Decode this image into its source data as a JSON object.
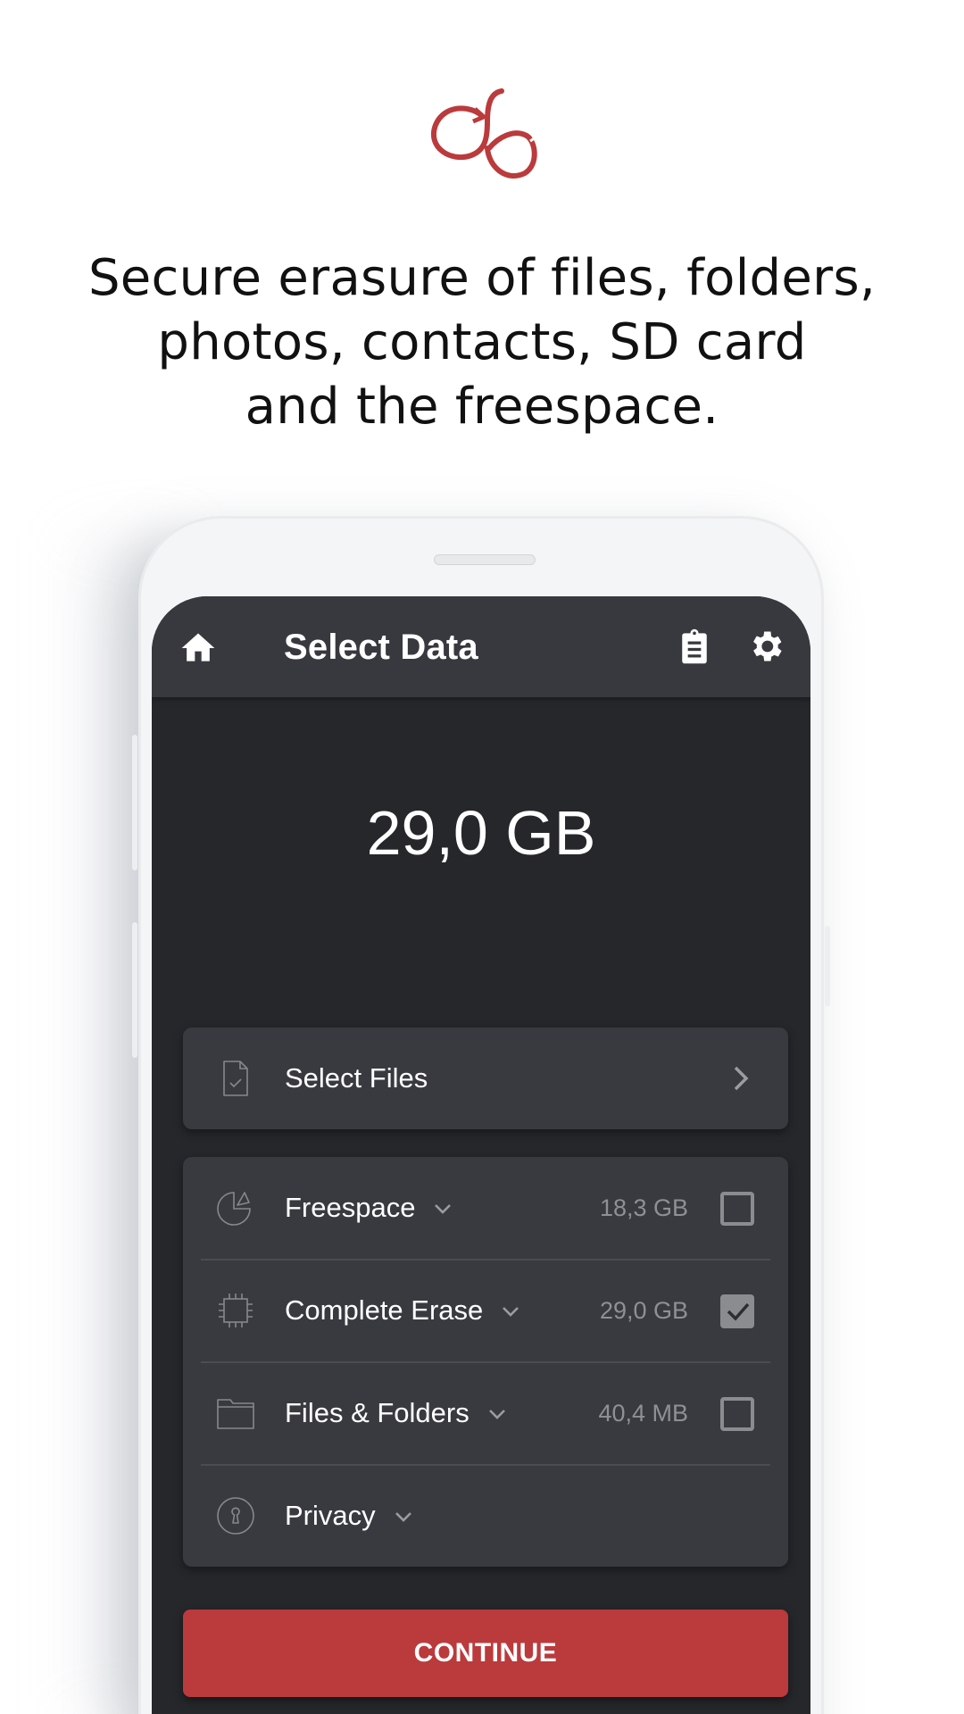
{
  "brand": {
    "logo_icon": "cb-monogram-logo",
    "accent_color": "#bb3a3c"
  },
  "tagline": {
    "lines": [
      "Secure erasure of files, folders,",
      "photos, contacts, SD card",
      "and the freespace."
    ]
  },
  "app": {
    "header": {
      "title": "Select Data",
      "home_icon": "home-icon",
      "report_icon": "clipboard-icon",
      "settings_icon": "gear-icon"
    },
    "total_size": "29,0 GB",
    "select_files": {
      "label": "Select Files",
      "icon": "file-check-icon",
      "chevron": "chevron-right-icon"
    },
    "options": [
      {
        "label": "Freespace",
        "icon": "pie-chart-icon",
        "size": "18,3 GB",
        "checked": false
      },
      {
        "label": "Complete Erase",
        "icon": "chip-icon",
        "size": "29,0 GB",
        "checked": true
      },
      {
        "label": "Files & Folders",
        "icon": "folder-icon",
        "size": "40,4 MB",
        "checked": false
      },
      {
        "label": "Privacy",
        "icon": "keyhole-icon",
        "size": null,
        "checked": null
      }
    ],
    "continue_label": "CONTINUE"
  }
}
